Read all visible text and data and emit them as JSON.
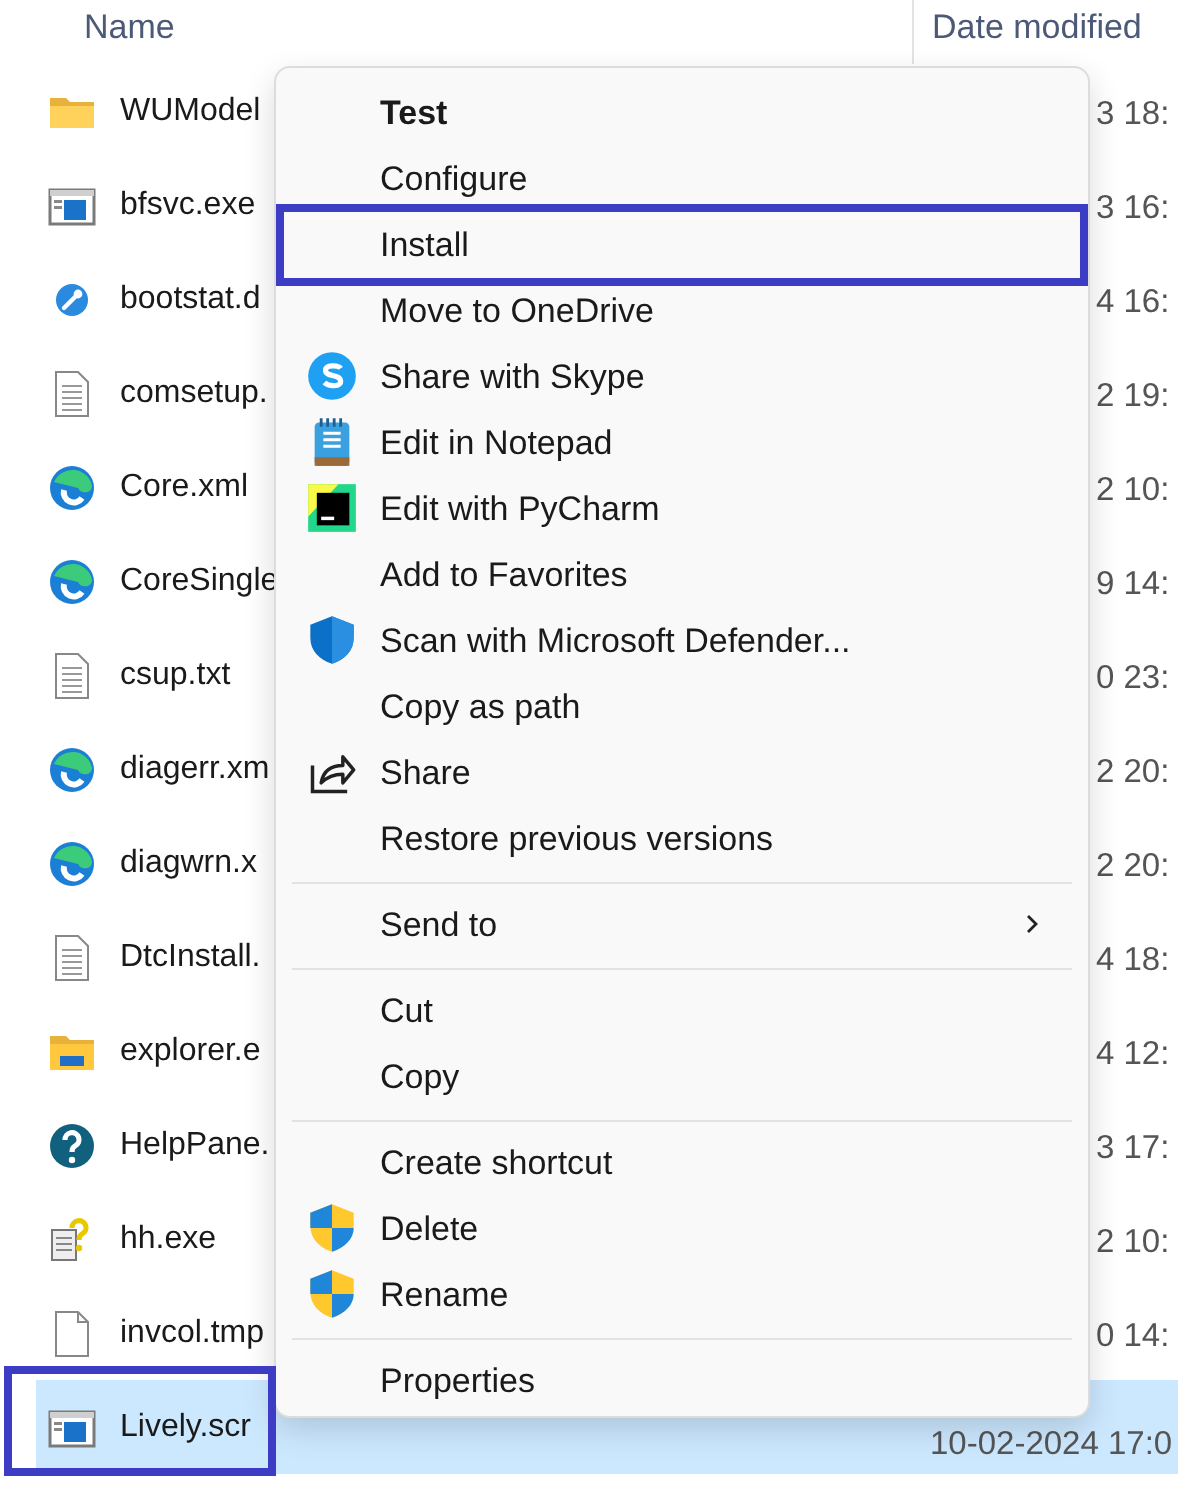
{
  "columns": [
    {
      "label": "Name"
    },
    {
      "label": "Date modified"
    }
  ],
  "files": [
    {
      "name": "WUModel",
      "kind": "folder",
      "date": "3 18:",
      "selected": false,
      "highlighted": false
    },
    {
      "name": "bfsvc.exe",
      "kind": "app",
      "date": "3 16:",
      "selected": false,
      "highlighted": false
    },
    {
      "name": "bootstat.d",
      "kind": "wrench",
      "date": "4 16:",
      "selected": false,
      "highlighted": false
    },
    {
      "name": "comsetup.",
      "kind": "text",
      "date": "2 19:",
      "selected": false,
      "highlighted": false
    },
    {
      "name": "Core.xml",
      "kind": "edge",
      "date": "2 10:",
      "selected": false,
      "highlighted": false
    },
    {
      "name": "CoreSingle",
      "kind": "edge",
      "date": "9 14:",
      "selected": false,
      "highlighted": false
    },
    {
      "name": "csup.txt",
      "kind": "text",
      "date": "0 23:",
      "selected": false,
      "highlighted": false
    },
    {
      "name": "diagerr.xm",
      "kind": "edge",
      "date": "2 20:",
      "selected": false,
      "highlighted": false
    },
    {
      "name": "diagwrn.x",
      "kind": "edge",
      "date": "2 20:",
      "selected": false,
      "highlighted": false
    },
    {
      "name": "DtcInstall.",
      "kind": "text",
      "date": "4 18:",
      "selected": false,
      "highlighted": false
    },
    {
      "name": "explorer.e",
      "kind": "explorer",
      "date": "4 12:",
      "selected": false,
      "highlighted": false
    },
    {
      "name": "HelpPane.",
      "kind": "help",
      "date": "3 17:",
      "selected": false,
      "highlighted": false
    },
    {
      "name": "hh.exe",
      "kind": "helpdoc",
      "date": "2 10:",
      "selected": false,
      "highlighted": false
    },
    {
      "name": "invcol.tmp",
      "kind": "blank",
      "date": "0 14:",
      "selected": false,
      "highlighted": false
    },
    {
      "name": "Lively.scr",
      "kind": "app",
      "date": "10-02-2024 17:0",
      "selected": true,
      "highlighted": true
    }
  ],
  "context_menu": {
    "groups": [
      [
        {
          "label": "Test",
          "kind": "plain",
          "default": true,
          "highlighted": false
        },
        {
          "label": "Configure",
          "kind": "plain",
          "default": false,
          "highlighted": false
        },
        {
          "label": "Install",
          "kind": "plain",
          "default": false,
          "highlighted": true
        },
        {
          "label": "Move to OneDrive",
          "kind": "plain",
          "default": false,
          "highlighted": false
        },
        {
          "label": "Share with Skype",
          "kind": "skype",
          "default": false,
          "highlighted": false
        },
        {
          "label": "Edit in Notepad",
          "kind": "notepad",
          "default": false,
          "highlighted": false
        },
        {
          "label": "Edit with PyCharm",
          "kind": "pycharm",
          "default": false,
          "highlighted": false
        },
        {
          "label": "Add to Favorites",
          "kind": "plain",
          "default": false,
          "highlighted": false
        },
        {
          "label": "Scan with Microsoft Defender...",
          "kind": "defender",
          "default": false,
          "highlighted": false
        },
        {
          "label": "Copy as path",
          "kind": "plain",
          "default": false,
          "highlighted": false
        },
        {
          "label": "Share",
          "kind": "share",
          "default": false,
          "highlighted": false
        },
        {
          "label": "Restore previous versions",
          "kind": "plain",
          "default": false,
          "highlighted": false
        }
      ],
      [
        {
          "label": "Send to",
          "kind": "submenu",
          "default": false,
          "highlighted": false
        }
      ],
      [
        {
          "label": "Cut",
          "kind": "plain",
          "default": false,
          "highlighted": false
        },
        {
          "label": "Copy",
          "kind": "plain",
          "default": false,
          "highlighted": false
        }
      ],
      [
        {
          "label": "Create shortcut",
          "kind": "plain",
          "default": false,
          "highlighted": false
        },
        {
          "label": "Delete",
          "kind": "uac",
          "default": false,
          "highlighted": false
        },
        {
          "label": "Rename",
          "kind": "uac",
          "default": false,
          "highlighted": false
        }
      ],
      [
        {
          "label": "Properties",
          "kind": "plain",
          "default": false,
          "highlighted": false
        }
      ]
    ]
  }
}
